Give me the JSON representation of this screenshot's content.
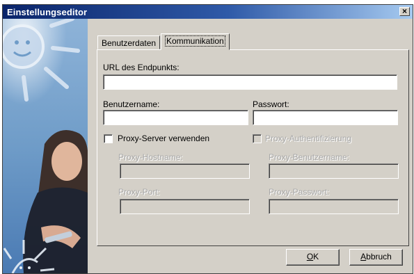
{
  "window": {
    "title": "Einstellungseditor",
    "close_glyph": "×"
  },
  "tabs": [
    {
      "label": "Benutzerdaten",
      "active": false
    },
    {
      "label": "Kommunikation",
      "active": true
    }
  ],
  "form": {
    "url_label": "URL des Endpunkts:",
    "url_value": "",
    "username_label": "Benutzername:",
    "username_value": "",
    "password_label": "Passwort:",
    "password_value": "",
    "proxy_checkbox_label": "Proxy-Server verwenden",
    "proxy_checked": false,
    "proxy_auth_checkbox_label": "Proxy-Authentifizierung",
    "proxy_auth_checked": false,
    "proxy_host_label": "Proxy-Hostname:",
    "proxy_user_label": "Proxy-Benutzername:",
    "proxy_port_label": "Proxy-Port:",
    "proxy_password_label": "Proxy-Passwort:"
  },
  "buttons": {
    "ok_mnemonic": "O",
    "ok_rest": "K",
    "cancel_mnemonic": "A",
    "cancel_rest": "bbruch"
  },
  "colors": {
    "dialog_bg": "#d4d0c8",
    "titlebar_start": "#0a246a",
    "titlebar_end": "#a6caf0",
    "side_image_blue": "#6f9cc8"
  },
  "icons": {
    "close": "close-icon",
    "sun": "sun-decoration"
  }
}
